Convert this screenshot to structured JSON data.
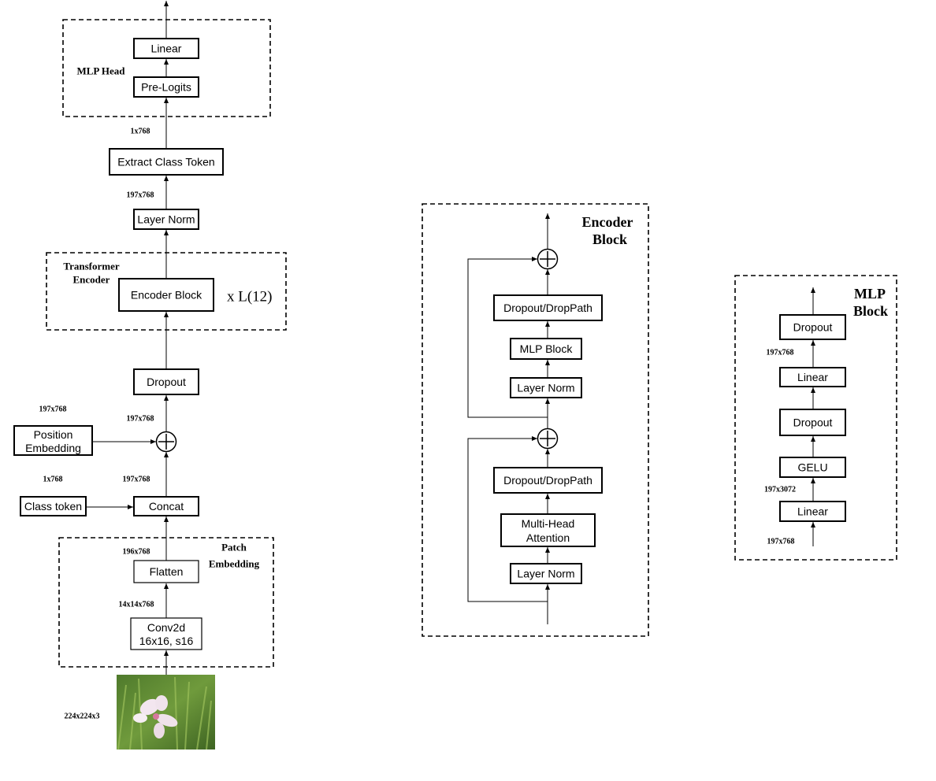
{
  "vit": {
    "mlp_head_label": "MLP Head",
    "linear": "Linear",
    "pre_logits": "Pre-Logits",
    "dim_1x768_top": "1x768",
    "extract_class_token": "Extract Class Token",
    "dim_197x768_a": "197x768",
    "layer_norm": "Layer Norm",
    "transformer_encoder_label_1": "Transformer",
    "transformer_encoder_label_2": "Encoder",
    "encoder_block": "Encoder Block",
    "repeat": "x L(12)",
    "dropout": "Dropout",
    "dim_pos_embed": "197x768",
    "dim_197x768_b": "197x768",
    "position_embedding_1": "Position",
    "position_embedding_2": "Embedding",
    "dim_class_token": "1x768",
    "dim_197x768_c": "197x768",
    "class_token": "Class token",
    "concat": "Concat",
    "patch_embedding_label_1": "Patch",
    "patch_embedding_label_2": "Embedding",
    "dim_196x768": "196x768",
    "flatten": "Flatten",
    "dim_14x14x768": "14x14x768",
    "conv2d_1": "Conv2d",
    "conv2d_2": "16x16, s16",
    "dim_input": "224x224x3"
  },
  "encoder_block": {
    "label_1": "Encoder",
    "label_2": "Block",
    "dropout_droppath_top": "Dropout/DropPath",
    "mlp_block": "MLP Block",
    "layer_norm_top": "Layer Norm",
    "dropout_droppath_bottom": "Dropout/DropPath",
    "mha_1": "Multi-Head",
    "mha_2": "Attention",
    "layer_norm_bottom": "Layer Norm"
  },
  "mlp_block": {
    "label_1": "MLP",
    "label_2": "Block",
    "dropout_top": "Dropout",
    "dim_out": "197x768",
    "linear_top": "Linear",
    "dropout_mid": "Dropout",
    "gelu": "GELU",
    "dim_hidden": "197x3072",
    "linear_bottom": "Linear",
    "dim_in": "197x768"
  }
}
